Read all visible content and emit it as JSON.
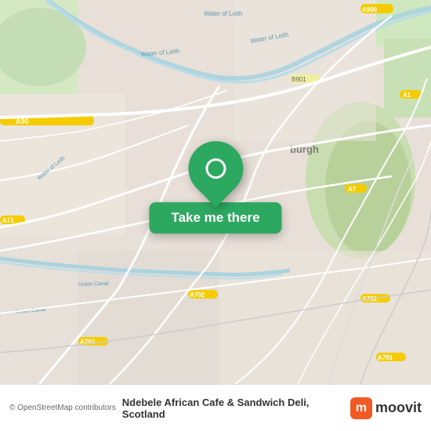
{
  "map": {
    "attribution": "© OpenStreetMap contributors",
    "city": "Edinburgh",
    "country": "Scotland"
  },
  "button": {
    "label": "Take me there"
  },
  "place": {
    "name": "Ndebele African Cafe & Sandwich Deli",
    "location": "Scotland"
  },
  "footer": {
    "attribution": "© OpenStreetMap contributors",
    "place_full": "Ndebele African Cafe & Sandwich Deli, Scotland",
    "moovit": "moovit"
  },
  "icons": {
    "pin": "location-pin-icon",
    "logo": "moovit-logo-icon"
  }
}
